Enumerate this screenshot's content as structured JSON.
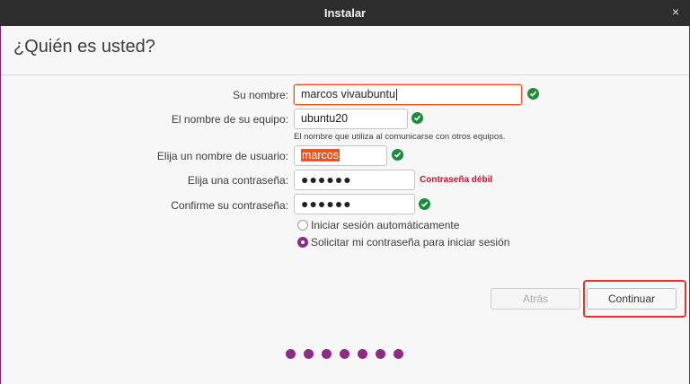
{
  "window": {
    "title": "Instalar",
    "close_glyph": "×"
  },
  "page": {
    "title": "¿Quién es usted?"
  },
  "form": {
    "name_label": "Su nombre:",
    "name_value": "marcos vivaubuntu",
    "computer_label": "El nombre de su equipo:",
    "computer_value": "ubuntu20",
    "computer_hint": "El nombre que utiliza al comunicarse con otros equipos.",
    "username_label": "Elija un nombre de usuario:",
    "username_value": "marcos",
    "password_label": "Elija una contraseña:",
    "password_value": "●●●●●●",
    "password_strength": "Contraseña débil",
    "confirm_label": "Confirme su contraseña:",
    "confirm_value": "●●●●●●",
    "option_autologin": "Iniciar sesión automáticamente",
    "option_require_password": "Solicitar mi contraseña para iniciar sesión",
    "selected_option": "require_password"
  },
  "buttons": {
    "back": "Atrás",
    "continue": "Continuar"
  },
  "progress": {
    "total_steps": 7
  },
  "colors": {
    "accent": "#e95420",
    "check": "#1c8c3b",
    "purple": "#8d2c85",
    "error": "#c7162b",
    "highlight": "#e53333"
  },
  "icons": {
    "valid": "check-circle-icon",
    "close": "close-icon"
  }
}
